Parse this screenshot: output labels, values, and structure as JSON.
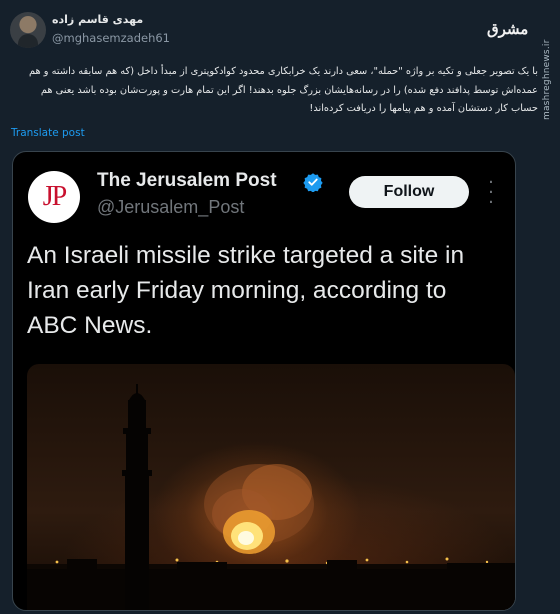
{
  "author": {
    "display_name": "مهدی قاسم زاده",
    "handle": "@mghasemzadeh61"
  },
  "brand": {
    "logo_text": "مشرق",
    "watermark": "mashreghnews.ir"
  },
  "tweet": {
    "text": "با یک تصویر جعلی و تکیه بر واژه \"حمله\"، سعی دارند یک خرابکاری محدود کوادکوپتری از مبدأ داخل (که هم سابقه داشته و هم عمده‌اش توسط پدافند دفع شده) را در رسانه‌هایشان بزرگ جلوه بدهند! اگر این تمام هارت و پورت‌شان بوده باشد یعنی هم حساب کار دستشان آمده و هم پیامها را دریافت کرده‌اند!",
    "translate_link": "Translate post"
  },
  "quoted": {
    "logo": "JP",
    "publisher": "The Jerusalem Post",
    "handle": "@Jerusalem_Post",
    "follow_label": "Follow",
    "headline": "An Israeli missile strike targeted a site in Iran early Friday morning, according to ABC News.",
    "verified_color": "#1d9bf0"
  },
  "colors": {
    "background": "#15202b",
    "link": "#1d9bf0",
    "card": "#000000"
  }
}
